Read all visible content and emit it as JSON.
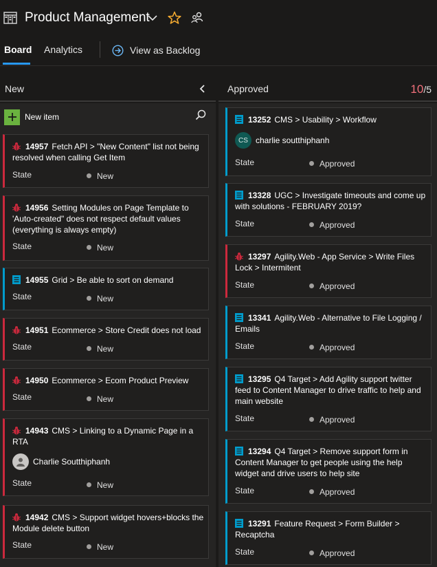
{
  "header": {
    "title": "Product Management",
    "icons": {
      "board": "board-icon",
      "dropdown": "chevron-down-icon",
      "favorite": "star-icon",
      "team": "team-members-icon"
    },
    "colors": {
      "favorite_star": "#f2a930",
      "accent": "#2899f5"
    }
  },
  "tabs": {
    "board": "Board",
    "analytics": "Analytics",
    "view_backlog": "View as Backlog"
  },
  "columns": {
    "new": {
      "title": "New",
      "new_item_label": "New item",
      "cards": [
        {
          "type": "bug",
          "id": "14957",
          "title": "Fetch API > \"New Content\" list not being resolved when calling Get Item",
          "state_label": "State",
          "state": "New"
        },
        {
          "type": "bug",
          "id": "14956",
          "title": "Setting Modules on Page Template to 'Auto-created\" does not respect default values (everything is always empty)",
          "state_label": "State",
          "state": "New"
        },
        {
          "type": "task",
          "id": "14955",
          "title": "Grid > Be able to sort on demand",
          "state_label": "State",
          "state": "New"
        },
        {
          "type": "bug",
          "id": "14951",
          "title": "Ecommerce  > Store Credit does not load",
          "state_label": "State",
          "state": "New"
        },
        {
          "type": "bug",
          "id": "14950",
          "title": "Ecommerce > Ecom Product Preview",
          "state_label": "State",
          "state": "New"
        },
        {
          "type": "bug",
          "id": "14943",
          "title": "CMS > Linking to a Dynamic Page in a RTA",
          "assignee": "Charlie Soutthiphanh",
          "state_label": "State",
          "state": "New"
        },
        {
          "type": "bug",
          "id": "14942",
          "title": "CMS > Support widget hovers+blocks the Module delete button",
          "state_label": "State",
          "state": "New"
        }
      ]
    },
    "approved": {
      "title": "Approved",
      "wip_count": "10",
      "wip_limit": "/5",
      "cards": [
        {
          "type": "task",
          "id": "13252",
          "title": "CMS > Usability > Workflow",
          "assignee": "charlie soutthiphanh",
          "assignee_initials": "CS",
          "state_label": "State",
          "state": "Approved"
        },
        {
          "type": "task",
          "id": "13328",
          "title": "UGC > Investigate timeouts and come up with solutions - FEBRUARY 2019?",
          "state_label": "State",
          "state": "Approved"
        },
        {
          "type": "bug",
          "id": "13297",
          "title": "Agility.Web - App Service > Write Files Lock > Intermitent",
          "state_label": "State",
          "state": "Approved"
        },
        {
          "type": "task",
          "id": "13341",
          "title": "Agility.Web - Alternative to File Logging / Emails",
          "state_label": "State",
          "state": "Approved"
        },
        {
          "type": "task",
          "id": "13295",
          "title": "Q4 Target > Add Agility support twitter feed to Content Manager to drive traffic to help and main website",
          "state_label": "State",
          "state": "Approved"
        },
        {
          "type": "task",
          "id": "13294",
          "title": "Q4 Target > Remove support form in Content Manager to get people using the help widget and drive users to help site",
          "state_label": "State",
          "state": "Approved"
        },
        {
          "type": "task",
          "id": "13291",
          "title": "Feature Request > Form Builder > Recaptcha",
          "state_label": "State",
          "state": "Approved"
        }
      ]
    }
  },
  "colors": {
    "bug": "#cc293d",
    "task": "#009ccc",
    "wip_over_limit": "#f1707b",
    "new_item_plus": "#6ab23f"
  }
}
